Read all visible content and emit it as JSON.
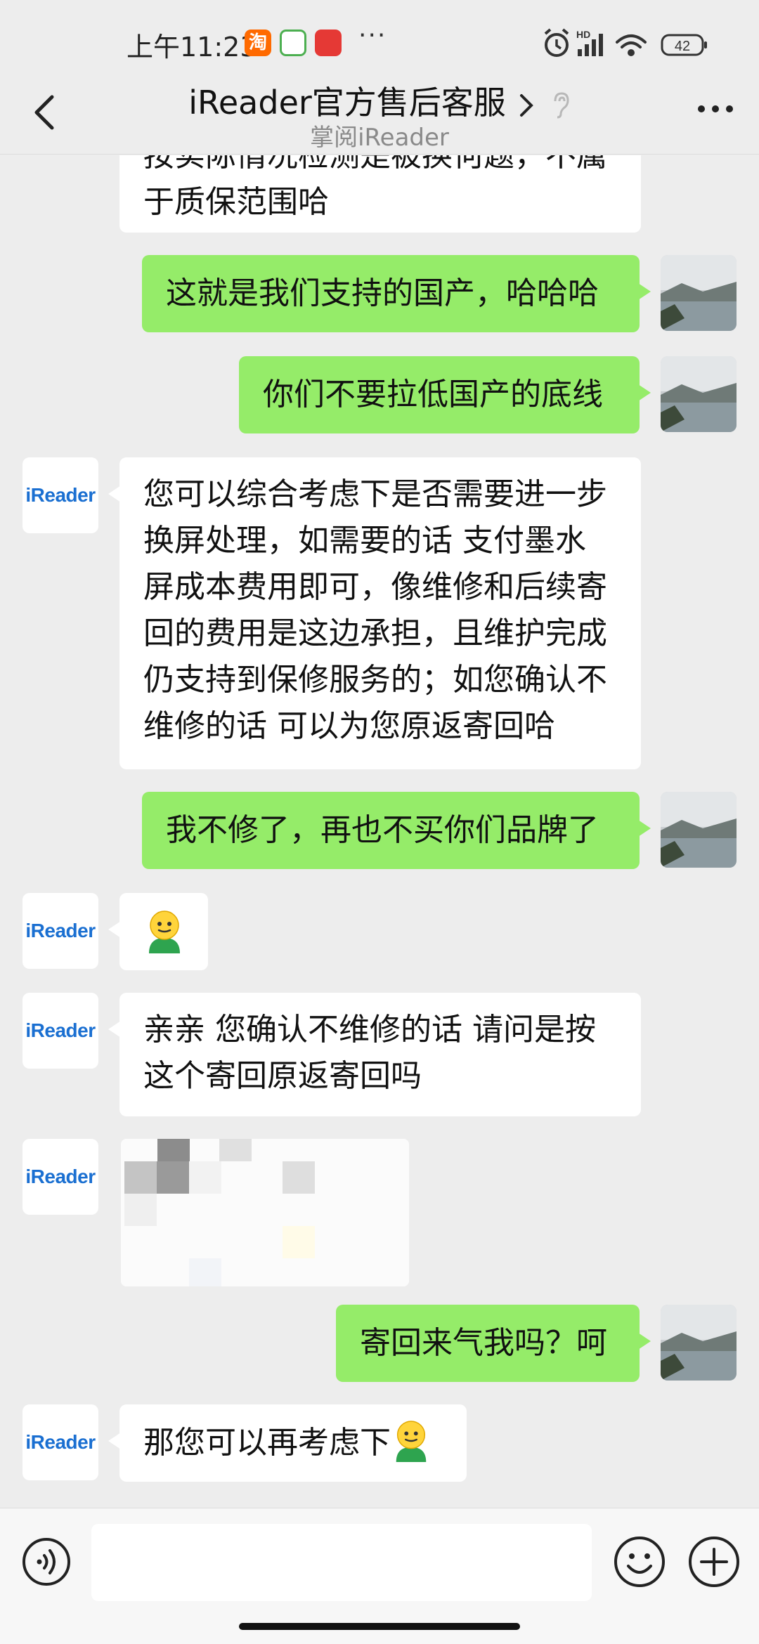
{
  "status_bar": {
    "time": "上午11:23",
    "battery": "42",
    "network": "HD",
    "more_dots": "···",
    "app_icon_taobao_label": "淘"
  },
  "header": {
    "title": "iReader官方售后客服",
    "subtitle": "掌阅iReader"
  },
  "messages": [
    {
      "side": "left",
      "lines": [
        "按实际情况检测是被换何题，不属",
        "于质保范围哈"
      ]
    },
    {
      "side": "right",
      "lines": [
        "这就是我们支持的国产，哈哈哈"
      ]
    },
    {
      "side": "right",
      "lines": [
        "你们不要拉低国产的底线"
      ]
    },
    {
      "side": "left",
      "avatar_text": "iReader",
      "lines": [
        "您可以综合考虑下是否需要进一步",
        "换屏处理，如需要的话 支付墨水",
        "屏成本费用即可，像维修和后续寄",
        "回的费用是这边承担，且维护完成",
        "仍支持到保修服务的；如您确认不",
        "维修的话 可以为您原返寄回哈"
      ]
    },
    {
      "side": "right",
      "lines": [
        "我不修了，再也不买你们品牌了"
      ]
    },
    {
      "side": "left",
      "avatar_text": "iReader",
      "emoji": "smiley-person"
    },
    {
      "side": "left",
      "avatar_text": "iReader",
      "lines": [
        "亲亲  您确认不维修的话 请问是按",
        "这个寄回原返寄回吗"
      ]
    },
    {
      "side": "left",
      "avatar_text": "iReader",
      "type": "image"
    },
    {
      "side": "right",
      "lines": [
        "寄回来气我吗？呵"
      ]
    },
    {
      "side": "left",
      "avatar_text": "iReader",
      "lines": [
        "那您可以再考虑下"
      ],
      "trailing_emoji": "smiley-person"
    }
  ],
  "colors": {
    "background": "#ededed",
    "right_bubble": "#95ec69",
    "left_bubble": "#ffffff",
    "brand_blue": "#1a6fd1"
  }
}
